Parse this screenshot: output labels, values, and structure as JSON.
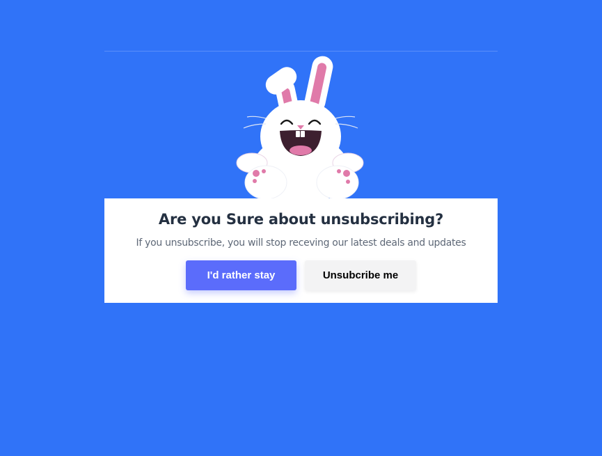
{
  "dialog": {
    "title": "Are you Sure about unsubscribing?",
    "subtitle": "If you unsubscribe, you will stop receving our latest deals and updates",
    "primary_button": "I'd rather stay",
    "secondary_button": "Unsubcribe me"
  },
  "illustration": {
    "icon": "happy-bunny-illustration"
  },
  "colors": {
    "background": "#3073f8",
    "card": "#ffffff",
    "primary_button": "#5b6cfb",
    "secondary_button": "#f3f3f4",
    "title_text": "#243041",
    "subtitle_text": "#5e6877",
    "bunny_pink": "#e07aa9"
  }
}
